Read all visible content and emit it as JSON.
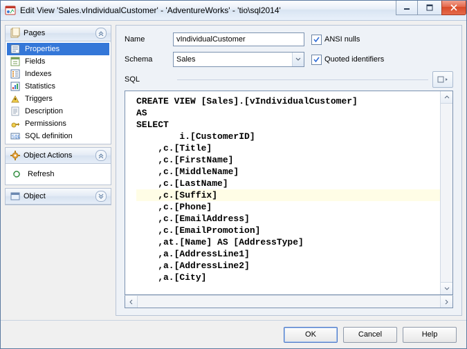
{
  "title": "Edit View 'Sales.vIndividualCustomer' - 'AdventureWorks' - 'tio\\sql2014'",
  "panels": {
    "pages": "Pages",
    "actions": "Object Actions",
    "object": "Object"
  },
  "pages": [
    {
      "label": "Properties",
      "selected": true
    },
    {
      "label": "Fields"
    },
    {
      "label": "Indexes"
    },
    {
      "label": "Statistics"
    },
    {
      "label": "Triggers"
    },
    {
      "label": "Description"
    },
    {
      "label": "Permissions"
    },
    {
      "label": "SQL definition"
    }
  ],
  "actions": {
    "refresh": "Refresh"
  },
  "form": {
    "name_label": "Name",
    "name_value": "vIndividualCustomer",
    "schema_label": "Schema",
    "schema_value": "Sales",
    "sql_label": "SQL",
    "ansi_label": "ANSI nulls",
    "ansi_checked": true,
    "quoted_label": "Quoted identifiers",
    "quoted_checked": true
  },
  "sql_lines": [
    {
      "t": "CREATE VIEW [Sales].[vIndividualCustomer]",
      "i": 0
    },
    {
      "t": "AS",
      "i": 0
    },
    {
      "t": "SELECT",
      "i": 0
    },
    {
      "t": "i.[CustomerID]",
      "i": 2
    },
    {
      "t": ",c.[Title]",
      "i": 1
    },
    {
      "t": ",c.[FirstName]",
      "i": 1
    },
    {
      "t": ",c.[MiddleName]",
      "i": 1
    },
    {
      "t": ",c.[LastName]",
      "i": 1
    },
    {
      "t": ",c.[Suffix]",
      "i": 1,
      "hl": true
    },
    {
      "t": ",c.[Phone]",
      "i": 1
    },
    {
      "t": ",c.[EmailAddress]",
      "i": 1
    },
    {
      "t": ",c.[EmailPromotion]",
      "i": 1
    },
    {
      "t": ",at.[Name] AS [AddressType]",
      "i": 1
    },
    {
      "t": ",a.[AddressLine1]",
      "i": 1
    },
    {
      "t": ",a.[AddressLine2]",
      "i": 1
    },
    {
      "t": ",a.[City]",
      "i": 1
    }
  ],
  "buttons": {
    "ok": "OK",
    "cancel": "Cancel",
    "help": "Help"
  }
}
